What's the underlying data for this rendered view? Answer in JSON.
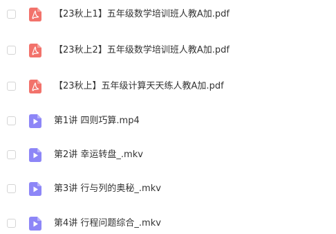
{
  "colors": {
    "pdf_icon": "#f2726b",
    "video_icon": "#8d86f7",
    "text": "#333333",
    "checkbox_border": "#d4d4d4"
  },
  "files": [
    {
      "name": "【23秋上1】五年级数学培训班人教A加.pdf",
      "icon": "pdf-icon"
    },
    {
      "name": "【23秋上2】五年级数学培训班人教A加.pdf",
      "icon": "pdf-icon"
    },
    {
      "name": "【23秋上】五年级计算天天练人教A加.pdf",
      "icon": "pdf-icon"
    },
    {
      "name": "第1讲 四则巧算.mp4",
      "icon": "video-icon"
    },
    {
      "name": "第2讲 幸运转盘_.mkv",
      "icon": "video-icon"
    },
    {
      "name": "第3讲 行与列的奥秘_.mkv",
      "icon": "video-icon"
    },
    {
      "name": "第4讲 行程问题综合_.mkv",
      "icon": "video-icon"
    }
  ]
}
